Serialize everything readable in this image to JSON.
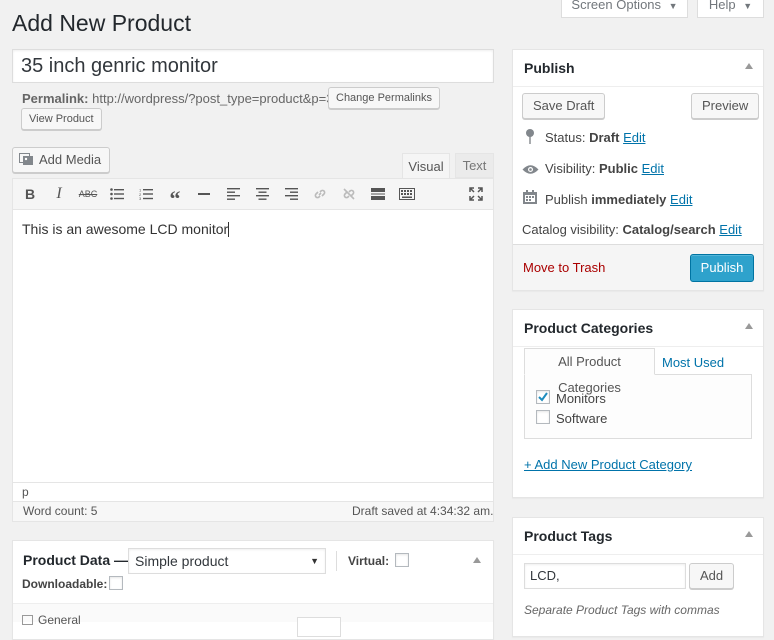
{
  "page": {
    "title": "Add New Product",
    "screen_options": "Screen Options",
    "help": "Help"
  },
  "product": {
    "title_value": "35 inch genric monitor",
    "permalink_label": "Permalink:",
    "permalink_url": "http://wordpress/?post_type=product&p=31",
    "change_permalinks": "Change Permalinks",
    "view_product": "View Product"
  },
  "editor": {
    "add_media": "Add Media",
    "tab_visual": "Visual",
    "tab_text": "Text",
    "content": "This is an awesome LCD monitor",
    "path": "p",
    "word_count": "Word count: 5",
    "draft_saved": "Draft saved at 4:34:32 am."
  },
  "publish": {
    "title": "Publish",
    "save_draft": "Save Draft",
    "preview": "Preview",
    "status_label": "Status:",
    "status_value": "Draft",
    "visibility_label": "Visibility:",
    "visibility_value": "Public",
    "publish_label": "Publish",
    "publish_value": "immediately",
    "catalog_label": "Catalog visibility:",
    "catalog_value": "Catalog/search",
    "edit": "Edit",
    "move_to_trash": "Move to Trash",
    "publish_button": "Publish",
    "publish_button_color": "#2ea2cc"
  },
  "categories": {
    "title": "Product Categories",
    "tab_all": "All Product Categories",
    "tab_most_used": "Most Used",
    "items": [
      {
        "label": "Monitors",
        "checked": true
      },
      {
        "label": "Software",
        "checked": false
      }
    ],
    "add_new": "+ Add New Product Category"
  },
  "tags": {
    "title": "Product Tags",
    "input_value": "LCD,",
    "add": "Add",
    "hint": "Separate Product Tags with commas"
  },
  "product_data": {
    "title": "Product Data —",
    "type_value": "Simple product",
    "virtual_label": "Virtual:",
    "downloadable_label": "Downloadable:",
    "general_tab": "General"
  }
}
